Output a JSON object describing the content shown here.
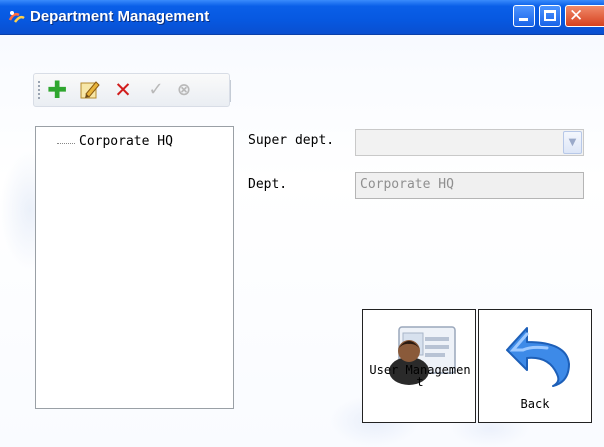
{
  "window": {
    "title": "Department Management",
    "controls": {
      "minimize": "minimize-icon",
      "maximize": "maximize-icon",
      "close": "close-icon"
    }
  },
  "toolbar": {
    "items": [
      {
        "name": "add",
        "icon": "plus-icon",
        "glyph": "✚"
      },
      {
        "name": "edit",
        "icon": "edit-icon",
        "glyph": ""
      },
      {
        "name": "delete",
        "icon": "delete-icon",
        "glyph": "✕"
      },
      {
        "name": "confirm",
        "icon": "check-icon",
        "glyph": "✓"
      },
      {
        "name": "cancel",
        "icon": "cancel-icon",
        "glyph": "⊗"
      }
    ]
  },
  "tree": {
    "root": "Corporate HQ"
  },
  "form": {
    "super_dept_label": "Super dept.",
    "super_dept_value": "",
    "dept_label": "Dept.",
    "dept_value": "Corporate HQ"
  },
  "buttons": {
    "user_management": "User Managemen t",
    "back": "Back"
  },
  "colors": {
    "titlebar": "#0758e0",
    "close_button": "#d6411f",
    "add_icon": "#2fa62f",
    "delete_icon": "#d11d1d",
    "back_arrow": "#2d7fe0"
  }
}
